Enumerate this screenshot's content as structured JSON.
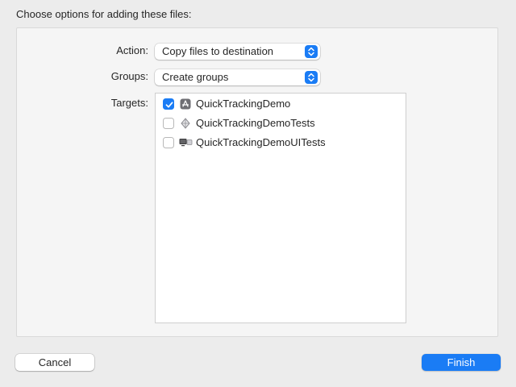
{
  "dialog": {
    "title": "Choose options for adding these files:"
  },
  "action": {
    "label": "Action:",
    "value": "Copy files to destination"
  },
  "groups": {
    "label": "Groups:",
    "value": "Create groups"
  },
  "targets": {
    "label": "Targets:",
    "items": [
      {
        "name": "QuickTrackingDemo",
        "checked": true,
        "icon": "app-target-icon"
      },
      {
        "name": "QuickTrackingDemoTests",
        "checked": false,
        "icon": "unit-test-target-icon"
      },
      {
        "name": "QuickTrackingDemoUITests",
        "checked": false,
        "icon": "ui-test-target-icon"
      }
    ]
  },
  "buttons": {
    "cancel": "Cancel",
    "finish": "Finish"
  },
  "colors": {
    "accent": "#1a7cf5",
    "background": "#ececec",
    "panel": "#f5f5f5"
  }
}
